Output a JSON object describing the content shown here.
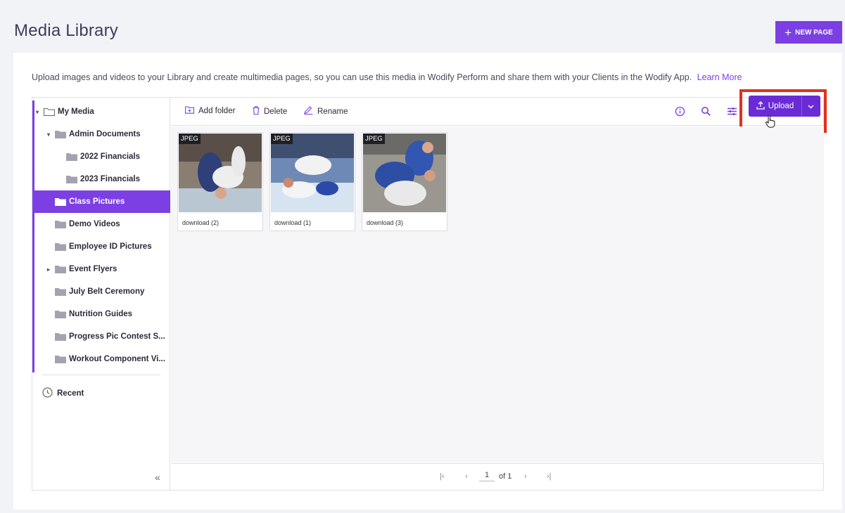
{
  "header": {
    "title": "Media Library",
    "new_page_label": "NEW PAGE"
  },
  "intro": {
    "text": "Upload images and videos to your Library and create multimedia pages, so you can use this media in Wodify Perform and share them with your Clients in the Wodify App.",
    "learn_more": "Learn More"
  },
  "sidebar": {
    "root": "My Media",
    "items": [
      {
        "label": "Admin Documents",
        "depth": 1,
        "caret": "down"
      },
      {
        "label": "2022 Financials",
        "depth": 2,
        "caret": ""
      },
      {
        "label": "2023 Financials",
        "depth": 2,
        "caret": ""
      },
      {
        "label": "Class Pictures",
        "depth": 1,
        "caret": "",
        "selected": true
      },
      {
        "label": "Demo Videos",
        "depth": 1,
        "caret": ""
      },
      {
        "label": "Employee ID Pictures",
        "depth": 1,
        "caret": ""
      },
      {
        "label": "Event Flyers",
        "depth": 1,
        "caret": "right"
      },
      {
        "label": "July Belt Ceremony",
        "depth": 1,
        "caret": ""
      },
      {
        "label": "Nutrition Guides",
        "depth": 1,
        "caret": ""
      },
      {
        "label": "Progress Pic Contest S...",
        "depth": 1,
        "caret": ""
      },
      {
        "label": "Workout Component Vi...",
        "depth": 1,
        "caret": ""
      }
    ],
    "recent": "Recent",
    "collapse": "«"
  },
  "toolbar": {
    "add_folder": "Add folder",
    "delete": "Delete",
    "rename": "Rename",
    "upload": "Upload",
    "accent": "#6a2bd6"
  },
  "media": [
    {
      "badge": "JPEG",
      "name": "download (2)"
    },
    {
      "badge": "JPEG",
      "name": "download (1)"
    },
    {
      "badge": "JPEG",
      "name": "download (3)"
    }
  ],
  "pagination": {
    "page": "1",
    "of": "of 1"
  }
}
